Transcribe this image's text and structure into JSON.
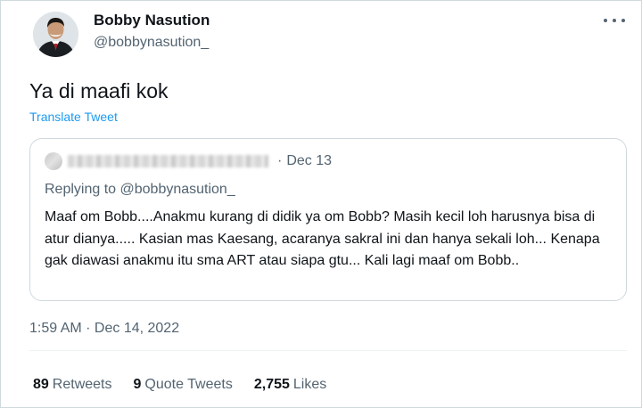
{
  "author": {
    "name": "Bobby Nasution",
    "handle": "@bobbynasution_"
  },
  "tweet": {
    "text": "Ya di maafi kok",
    "translate_label": "Translate Tweet"
  },
  "quote": {
    "date_sep": "·",
    "date": "Dec 13",
    "replying_prefix": "Replying to",
    "replying_handle": "@bobbynasution_",
    "text": "Maaf om Bobb....Anakmu kurang di didik ya om Bobb? Masih kecil loh harusnya bisa di atur dianya..... Kasian mas Kaesang, acaranya sakral ini dan hanya sekali loh... Kenapa gak diawasi anakmu itu sma ART atau siapa gtu... Kali lagi maaf om Bobb.."
  },
  "timestamp": "1:59 AM · Dec 14, 2022",
  "stats": {
    "retweets_count": "89",
    "retweets_label": "Retweets",
    "quotes_count": "9",
    "quotes_label": "Quote Tweets",
    "likes_count": "2,755",
    "likes_label": "Likes"
  },
  "icons": {
    "more": "more-horizontal-icon"
  },
  "colors": {
    "link": "#1d9bf0",
    "secondary_text": "#536471",
    "primary_text": "#0f1419",
    "border": "#cfd9de"
  }
}
